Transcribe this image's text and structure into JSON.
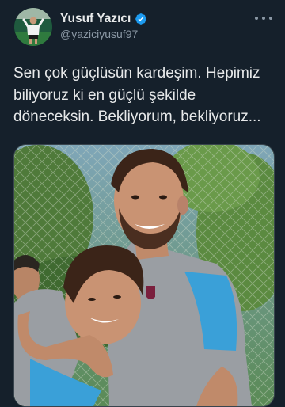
{
  "author": {
    "display_name": "Yusuf Yazıcı",
    "handle": "@yaziciyusuf97",
    "verified": true,
    "avatar_icon": "profile-photo"
  },
  "tweet": {
    "lines": [
      "Sen çok güçlüsün kardeşim. Hepimiz",
      "biliyoruz ki en güçlü şekilde",
      "döneceksin. Bekliyorum, bekliyoruz..."
    ]
  },
  "media": {
    "icon": "photo-two-players-hugging"
  },
  "colors": {
    "background": "#15202b",
    "text_primary": "#e7e9ea",
    "text_secondary": "#8b98a5",
    "verified_badge": "#1d9bf0",
    "border": "#38444d"
  }
}
